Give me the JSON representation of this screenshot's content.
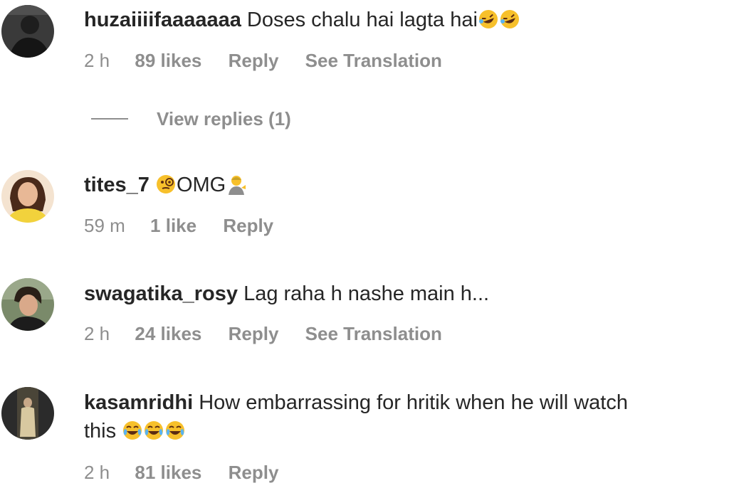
{
  "comments": [
    {
      "username": "huzaiiiifaaaaaaa",
      "text": "Doses chalu hai lagta hai",
      "emojis": [
        "rofl",
        "rofl"
      ],
      "time": "2 h",
      "likes": "89 likes",
      "reply": "Reply",
      "translate": "See Translation",
      "view_replies": "View replies (1)"
    },
    {
      "username": "tites_7",
      "text": "OMG",
      "emoji_before": "face-with-monocle",
      "emoji_after": "person-tipping-hand",
      "time": "59 m",
      "likes": "1 like",
      "reply": "Reply"
    },
    {
      "username": "swagatika_rosy",
      "text": "Lag raha h nashe main h...",
      "time": "2 h",
      "likes": "24 likes",
      "reply": "Reply",
      "translate": "See Translation"
    },
    {
      "username": "kasamridhi",
      "text": "How embarrassing for hritik when he will watch",
      "text_line2": "this",
      "emojis": [
        "tears-of-joy",
        "tears-of-joy",
        "tears-of-joy"
      ],
      "time": "2 h",
      "likes": "81 likes",
      "reply": "Reply"
    }
  ],
  "colors": {
    "primary_text": "#262626",
    "secondary_text": "#8e8e8e"
  }
}
